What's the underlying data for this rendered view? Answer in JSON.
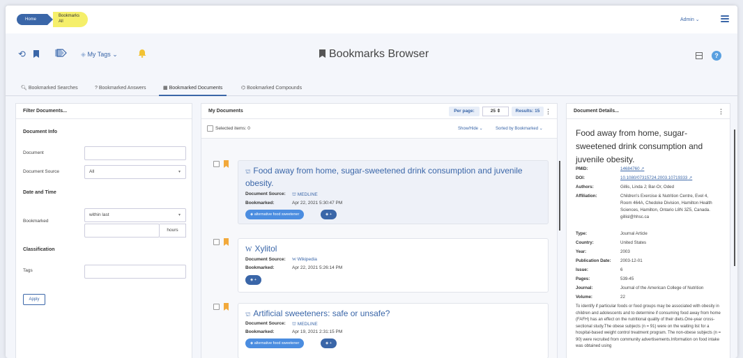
{
  "breadcrumb": {
    "home": "Home",
    "current_line1": "Bookmarks",
    "current_line2": "All"
  },
  "header": {
    "user": "Admin ⌄"
  },
  "toolbar": {
    "my_tags": "My Tags ⌄",
    "title": "Bookmarks Browser"
  },
  "tabs": [
    {
      "icon": "🔍︎",
      "label": "Bookmarked Searches"
    },
    {
      "icon": "?",
      "label": "Bookmarked Answers"
    },
    {
      "icon": "▦",
      "label": "Bookmarked Documents"
    },
    {
      "icon": "⌬",
      "label": "Bookmarked Compounds"
    }
  ],
  "filter": {
    "title": "Filter Documents...",
    "doc_info": "Document Info",
    "document": "Document",
    "doc_source": "Document Source",
    "doc_source_value": "All",
    "date_time": "Date and Time",
    "bookmarked": "Bookmarked",
    "within_last": "within last",
    "hours": "hours",
    "classification": "Classification",
    "tags": "Tags",
    "apply": "Apply"
  },
  "docs": {
    "title": "My Documents",
    "per_page_label": "Per page:",
    "per_page_value": "25 ⇕",
    "results": "Results: 15",
    "selected": "Selected items: 0",
    "show_hide": "Show/Hide ⌄",
    "sorted": "Sorted by Bookmarked ⌄",
    "source_label": "Document Source:",
    "bookmarked_label": "Bookmarked:",
    "items": [
      {
        "title": "Food away from home, sugar-sweetened drink consumption and juvenile obesity.",
        "source": "MEDLINE",
        "date": "Apr 22, 2021 5:30:47 PM",
        "tag": "alternative food sweetener",
        "add": "+"
      },
      {
        "title": "Xylitol",
        "source": "Wikipedia",
        "date": "Apr 22, 2021 5:26:14 PM",
        "add": "+"
      },
      {
        "title": "Artificial sweeteners: safe or unsafe?",
        "source": "MEDLINE",
        "date": "Apr 19, 2021 2:31:15 PM",
        "tag": "alternative food sweetener",
        "add": "+"
      }
    ]
  },
  "details": {
    "title": "Document Details...",
    "doc_title": "Food away from home, sugar-sweetened drink consumption and juvenile obesity.",
    "fields": {
      "pmid_k": "PMID:",
      "pmid_v": "14684760",
      "doi_k": "DOI:",
      "doi_v": "10.1080/07315724.2003.10719333",
      "authors_k": "Authors:",
      "authors_v": "Gillis, Linda J; Bar-Or, Oded",
      "affil_k": "Affiliation:",
      "affil_v": "Children's Exercise & Nutrition Centre, Evel 4, Room 464A, Chedoke Division, Hamilton Health Sciences, Hamilton, Ontario L8N 3Z5, Canada. gillisl@hhsc.ca",
      "type_k": "Type:",
      "type_v": "Journal Article",
      "country_k": "Country:",
      "country_v": "United States",
      "year_k": "Year:",
      "year_v": "2003",
      "pubdate_k": "Publication Date:",
      "pubdate_v": "2003-12-01",
      "issue_k": "Issue:",
      "issue_v": "6",
      "pages_k": "Pages:",
      "pages_v": "539-45",
      "journal_k": "Journal:",
      "journal_v": "Journal of the American College of Nutrition",
      "volume_k": "Volume:",
      "volume_v": "22"
    },
    "abstract": "To identify if particular foods or food groups may be associated with obesity in children and adolescents and to determine if consuming food away from home (FAFH) has an effect on the nutritional quality of their diets.One-year cross-sectional study.The obese subjects (n = 91) were on the waiting list for a hospital-based weight control treatment program. The non-obese subjects (n = 90) were recruited from community advertisements.Information on food intake was obtained using"
  },
  "colors": {
    "primary": "#3a66a8",
    "breadcrumb_active": "#f5ef6a",
    "tag_pill": "#4b8de0",
    "bookmark": "#f2a93b",
    "bell": "#f2c233"
  }
}
